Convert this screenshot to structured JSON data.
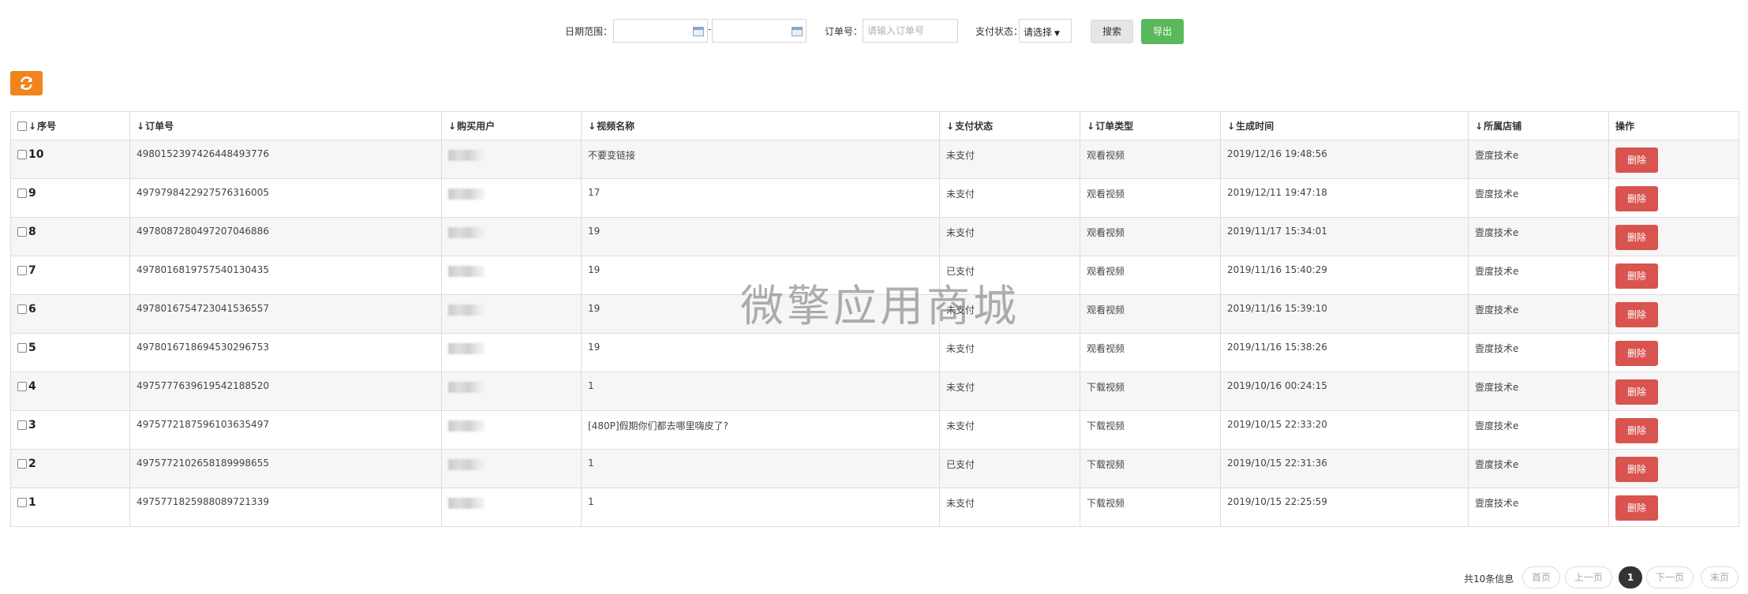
{
  "filters": {
    "date_range_label": "日期范围：",
    "date_separator": "-",
    "order_no_label": "订单号：",
    "order_no_value": "",
    "order_no_placeholder": "请输入订单号",
    "pay_status_label": "支付状态：",
    "pay_status_selected": "请选择",
    "search_button": "搜索",
    "export_button": "导出"
  },
  "table": {
    "headers": [
      "序号",
      "订单号",
      "购买用户",
      "视频名称",
      "支付状态",
      "订单类型",
      "生成时间",
      "所属店铺",
      "操作"
    ],
    "rows": [
      {
        "index": "10",
        "order_no": "4980152397426448493776",
        "video": "不要变链接",
        "pay_status": "未支付",
        "order_type": "观看视频",
        "created": "2019/12/16 19:48:56",
        "shop": "壹度技术e",
        "action": "删除"
      },
      {
        "index": "9",
        "order_no": "4979798422927576316005",
        "video": "17",
        "pay_status": "未支付",
        "order_type": "观看视频",
        "created": "2019/12/11 19:47:18",
        "shop": "壹度技术e",
        "action": "删除"
      },
      {
        "index": "8",
        "order_no": "4978087280497207046886",
        "video": "19",
        "pay_status": "未支付",
        "order_type": "观看视频",
        "created": "2019/11/17 15:34:01",
        "shop": "壹度技术e",
        "action": "删除"
      },
      {
        "index": "7",
        "order_no": "4978016819757540130435",
        "video": "19",
        "pay_status": "已支付",
        "order_type": "观看视频",
        "created": "2019/11/16 15:40:29",
        "shop": "壹度技术e",
        "action": "删除"
      },
      {
        "index": "6",
        "order_no": "4978016754723041536557",
        "video": "19",
        "pay_status": "未支付",
        "order_type": "观看视频",
        "created": "2019/11/16 15:39:10",
        "shop": "壹度技术e",
        "action": "删除"
      },
      {
        "index": "5",
        "order_no": "4978016718694530296753",
        "video": "19",
        "pay_status": "未支付",
        "order_type": "观看视频",
        "created": "2019/11/16 15:38:26",
        "shop": "壹度技术e",
        "action": "删除"
      },
      {
        "index": "4",
        "order_no": "4975777639619542188520",
        "video": "1",
        "pay_status": "未支付",
        "order_type": "下载视频",
        "created": "2019/10/16 00:24:15",
        "shop": "壹度技术e",
        "action": "删除"
      },
      {
        "index": "3",
        "order_no": "4975772187596103635497",
        "video": "[480P]假期你们都去哪里嗨皮了?",
        "pay_status": "未支付",
        "order_type": "下载视频",
        "created": "2019/10/15 22:33:20",
        "shop": "壹度技术e",
        "action": "删除"
      },
      {
        "index": "2",
        "order_no": "4975772102658189998655",
        "video": "1",
        "pay_status": "已支付",
        "order_type": "下载视频",
        "created": "2019/10/15 22:31:36",
        "shop": "壹度技术e",
        "action": "删除"
      },
      {
        "index": "1",
        "order_no": "4975771825988089721339",
        "video": "1",
        "pay_status": "未支付",
        "order_type": "下载视频",
        "created": "2019/10/15 22:25:59",
        "shop": "壹度技术e",
        "action": "删除"
      }
    ]
  },
  "watermark": "微擎应用商城",
  "pagination": {
    "total_text": "共10条信息",
    "first": "首页",
    "prev": "上一页",
    "current": "1",
    "next": "下一页",
    "last": "末页"
  },
  "colors": {
    "export_green": "#5cb85c",
    "refresh_orange": "#f0841f",
    "delete_red": "#d9534f"
  }
}
